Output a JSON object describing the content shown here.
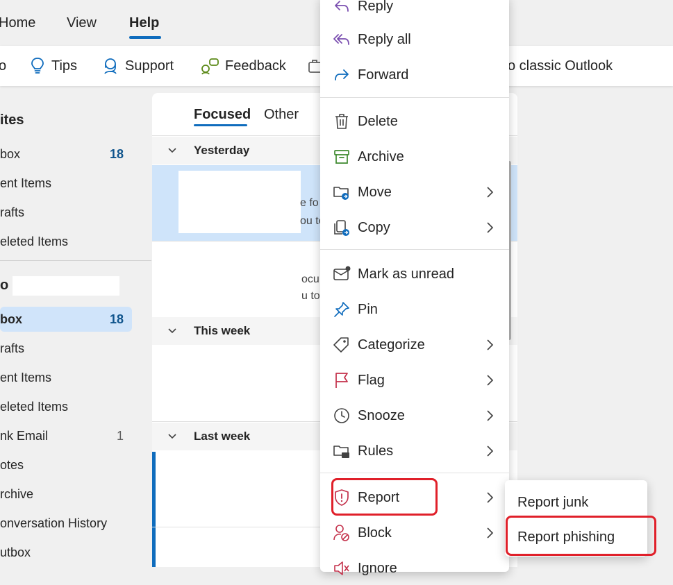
{
  "top_tabs": [
    "Home",
    "View",
    "Help"
  ],
  "ribbon": {
    "partial_left": "o",
    "tips": "Tips",
    "support": "Support",
    "feedback": "Feedback",
    "classic": "o classic Outlook"
  },
  "sidebar": {
    "favorites_header": "ites",
    "favorites": [
      {
        "label": "box",
        "count": "18"
      },
      {
        "label": "ent Items",
        "count": ""
      },
      {
        "label": "rafts",
        "count": ""
      },
      {
        "label": "eleted Items",
        "count": ""
      }
    ],
    "account_header": "o",
    "account_items": [
      {
        "label": "box",
        "count": "18"
      },
      {
        "label": "rafts",
        "count": ""
      },
      {
        "label": "ent Items",
        "count": ""
      },
      {
        "label": "eleted Items",
        "count": ""
      },
      {
        "label": "nk Email",
        "count": "1"
      },
      {
        "label": "otes",
        "count": ""
      },
      {
        "label": "rchive",
        "count": ""
      },
      {
        "label": "onversation History",
        "count": ""
      },
      {
        "label": "utbox",
        "count": ""
      }
    ]
  },
  "mail_list": {
    "tabs": [
      "Focused",
      "Other"
    ],
    "groups": [
      "Yesterday",
      "This week",
      "Last week"
    ],
    "fragments": {
      "m1a": "e fo",
      "m1b": "ou to",
      "m2a": "ocu",
      "m2b": "u to"
    }
  },
  "context_menu": {
    "items": [
      "Reply",
      "Reply all",
      "Forward",
      "Delete",
      "Archive",
      "Move",
      "Copy",
      "Mark as unread",
      "Pin",
      "Categorize",
      "Flag",
      "Snooze",
      "Rules",
      "Report",
      "Block",
      "Ignore"
    ]
  },
  "submenu": {
    "items": [
      "Report junk",
      "Report phishing"
    ]
  },
  "colors": {
    "accent": "#0f6cbd",
    "selected": "#cfe4fa",
    "annotation": "#e0202a"
  }
}
